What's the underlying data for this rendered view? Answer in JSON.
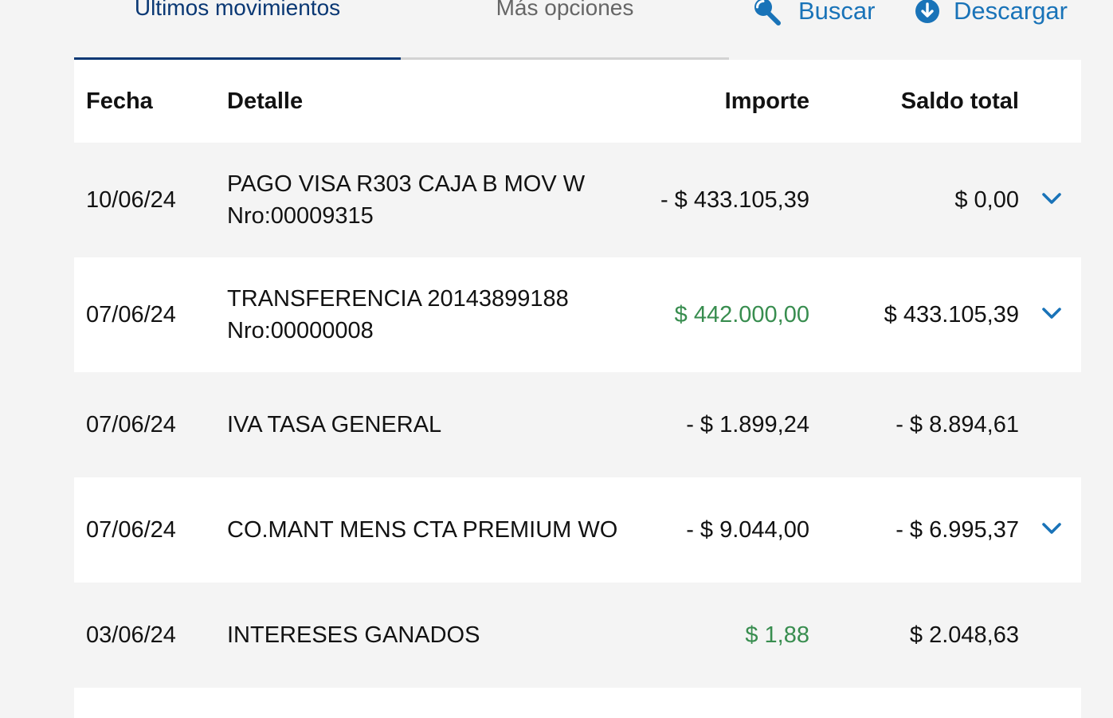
{
  "tabs": {
    "movimientos": "Ultimos movimientos",
    "opciones": "Más opciones"
  },
  "actions": {
    "buscar": "Buscar",
    "descargar": "Descargar"
  },
  "colors": {
    "accent": "#1973b8",
    "active_tab": "#0a3874",
    "positive_amount": "#388d4f"
  },
  "table": {
    "headers": {
      "fecha": "Fecha",
      "detalle": "Detalle",
      "importe": "Importe",
      "saldo": "Saldo total"
    },
    "rows": [
      {
        "fecha": "10/06/24",
        "detalle": "PAGO VISA R303 CAJA B MOV W",
        "detalle2": "Nro:00009315",
        "importe": "- $ 433.105,39",
        "saldo": "$ 0,00",
        "positive": false,
        "expandable": true
      },
      {
        "fecha": "07/06/24",
        "detalle": "TRANSFERENCIA 20143899188",
        "detalle2": "Nro:00000008",
        "importe": "$ 442.000,00",
        "saldo": "$ 433.105,39",
        "positive": true,
        "expandable": true
      },
      {
        "fecha": "07/06/24",
        "detalle": "IVA TASA GENERAL",
        "importe": "- $ 1.899,24",
        "saldo": "- $ 8.894,61",
        "positive": false,
        "expandable": false
      },
      {
        "fecha": "07/06/24",
        "detalle": "CO.MANT MENS CTA PREMIUM WO",
        "importe": "- $ 9.044,00",
        "saldo": "- $ 6.995,37",
        "positive": false,
        "expandable": true
      },
      {
        "fecha": "03/06/24",
        "detalle": "INTERESES GANADOS",
        "importe": "$ 1,88",
        "saldo": "$ 2.048,63",
        "positive": true,
        "expandable": false
      }
    ]
  }
}
